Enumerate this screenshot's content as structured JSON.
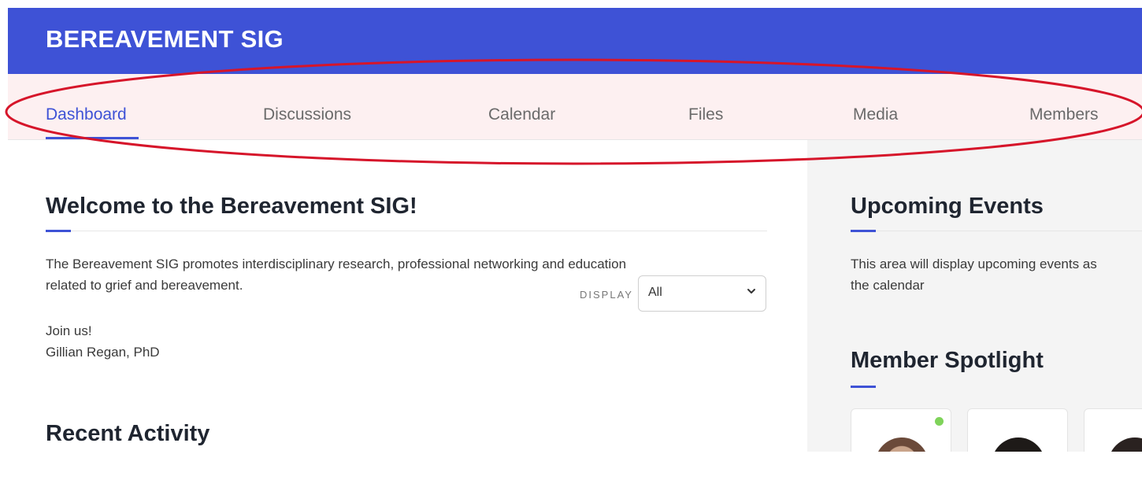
{
  "header": {
    "title": "BEREAVEMENT SIG",
    "color": "#3e52d6"
  },
  "nav": {
    "active": "Dashboard",
    "items": [
      {
        "label": "Dashboard"
      },
      {
        "label": "Discussions"
      },
      {
        "label": "Calendar"
      },
      {
        "label": "Files"
      },
      {
        "label": "Media"
      },
      {
        "label": "Members"
      }
    ]
  },
  "welcome": {
    "title": "Welcome to the Bereavement SIG!",
    "body_line1": "The Bereavement SIG promotes interdisciplinary research, professional networking and education",
    "body_line2": "related to grief and bereavement.",
    "join": "Join us!",
    "signature": "Gillian Regan, PhD"
  },
  "recent_activity": {
    "title": "Recent Activity",
    "display_label": "DISPLAY",
    "display_value": "All"
  },
  "upcoming_events": {
    "title": "Upcoming Events",
    "body_line1": "This area will display upcoming events as",
    "body_line2": "the calendar"
  },
  "member_spotlight": {
    "title": "Member Spotlight",
    "members": [
      {
        "online": true
      },
      {
        "online": false
      },
      {
        "online": false
      }
    ]
  },
  "annotation": {
    "color": "#d6152a"
  }
}
